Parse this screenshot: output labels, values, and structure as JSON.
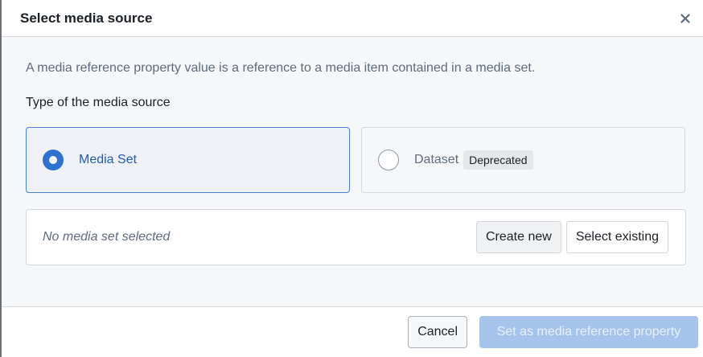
{
  "dialog": {
    "title": "Select media source",
    "close_icon": "close-icon"
  },
  "body": {
    "description": "A media reference property value is a reference to a media item contained in a media set.",
    "source_type_label": "Type of the media source",
    "options": [
      {
        "label": "Media Set",
        "selected": true
      },
      {
        "label": "Dataset",
        "selected": false,
        "badge": "Deprecated"
      }
    ],
    "selection": {
      "empty_text": "No media set selected",
      "create_new_label": "Create new",
      "select_existing_label": "Select existing"
    }
  },
  "footer": {
    "cancel_label": "Cancel",
    "submit_label": "Set as media reference property",
    "submit_disabled": true
  },
  "colors": {
    "accent": "#2d72d2",
    "selected_border": "#4c7ed6",
    "disabled_primary": "#a6c3ec"
  }
}
